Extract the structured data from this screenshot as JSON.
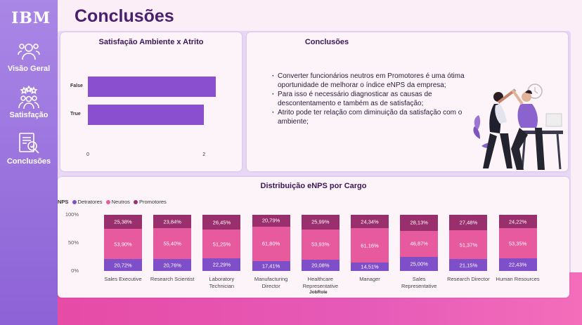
{
  "sidebar": {
    "logo": "IBM",
    "items": [
      {
        "label": "Visão Geral",
        "icon": "team-icon"
      },
      {
        "label": "Satisfação",
        "icon": "rating-icon"
      },
      {
        "label": "Conclusões",
        "icon": "report-icon"
      }
    ]
  },
  "page": {
    "title": "Conclusões"
  },
  "satisfaction_chart": {
    "chart_data": {
      "type": "bar",
      "orientation": "horizontal",
      "title": "Satisfação Ambiente x Atrito",
      "categories": [
        "False",
        "True"
      ],
      "values": [
        2.2,
        2.0
      ],
      "xticks": [
        "0",
        "2"
      ],
      "xlim": [
        0,
        2.3
      ],
      "color": "#8a4fcf"
    }
  },
  "conclusions": {
    "title": "Conclusões",
    "items": [
      "Converter funcionários neutros em Promotores é uma ótima oportunidade de melhorar o índice eNPS da empresa;",
      "Para isso é necessário diagnosticar as causas de descontentamento e também as de satisfação;",
      "Atrito pode ter relação com diminuição da satisfação com o ambiente;"
    ]
  },
  "enps_chart": {
    "chart_data": {
      "type": "bar",
      "stacked": true,
      "title": "Distribuição eNPS por Cargo",
      "legend_title": "NPS",
      "xlabel": "JobRole",
      "yticks": [
        "100%",
        "50%",
        "0%"
      ],
      "categories": [
        "Sales Executive",
        "Research Scientist",
        "Laboratory Technician",
        "Manufacturing Director",
        "Healthcare Representative",
        "Manager",
        "Sales Representative",
        "Research Director",
        "Human Resources"
      ],
      "series": [
        {
          "name": "Detratores",
          "color": "#7f4fc9",
          "values": [
            20.72,
            20.76,
            22.29,
            17.41,
            20.08,
            14.51,
            25.0,
            21.15,
            22.43
          ],
          "labels": [
            "20,72%",
            "20,76%",
            "22,29%",
            "17,41%",
            "20,08%",
            "14,51%",
            "25,00%",
            "21,15%",
            "22,43%"
          ]
        },
        {
          "name": "Neutros",
          "color": "#e85a9e",
          "values": [
            53.9,
            55.4,
            51.25,
            61.8,
            53.93,
            61.16,
            46.87,
            51.37,
            53.35
          ],
          "labels": [
            "53,90%",
            "55,40%",
            "51,25%",
            "61,80%",
            "53,93%",
            "61,16%",
            "46,87%",
            "51,37%",
            "53,35%"
          ]
        },
        {
          "name": "Promotores",
          "color": "#9a2f6e",
          "values": [
            25.38,
            23.84,
            26.45,
            20.79,
            25.99,
            24.34,
            28.13,
            27.48,
            24.22
          ],
          "labels": [
            "25,38%",
            "23,84%",
            "26,45%",
            "20,79%",
            "25,99%",
            "24,34%",
            "28,13%",
            "27,48%",
            "24,22%"
          ]
        }
      ],
      "ylim": [
        0,
        100
      ]
    }
  }
}
